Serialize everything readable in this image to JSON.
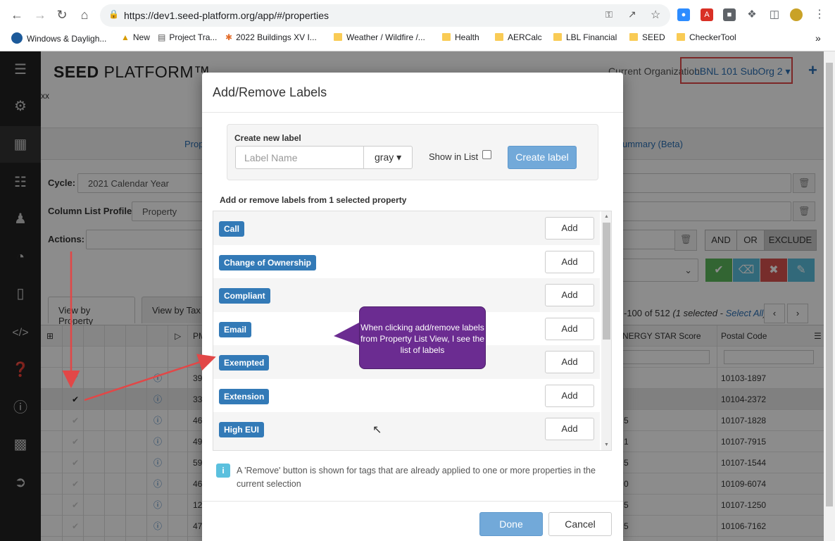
{
  "browser": {
    "url": "https://dev1.seed-platform.org/app/#/properties",
    "bookmarks": [
      "Windows & Dayligh...",
      "New",
      "Project Tra...",
      "2022 Buildings XV I...",
      "Weather / Wildfire /...",
      "Health",
      "AERCalc",
      "LBL Financial",
      "SEED",
      "CheckerTool"
    ]
  },
  "app": {
    "brand_bold": "SEED",
    "brand_rest": " PLATFORM™",
    "current_org_label": "Current Organization:",
    "current_org": "LBNL 101 SubOrg 2 ▾",
    "stray_text": "xx",
    "tab_prop": "Prop",
    "tab_summary": "ummary (Beta)",
    "cycle_label": "Cycle:",
    "cycle_value": "2021 Calendar Year",
    "column_profile_label": "Column List Profile:",
    "column_profile_value": "Property",
    "actions_label": "Actions:",
    "filter_buttons": [
      "AND",
      "OR",
      "EXCLUDE"
    ],
    "view_tabs": [
      "View by Property",
      "View by Tax L"
    ],
    "pagination": "-100 of 512",
    "pagination_selected": "(1 selected - ",
    "select_all": "Select All",
    "pagination_close": ")",
    "col_energy_star": "NERGY STAR Score",
    "col_postal": "Postal Code",
    "col_pm": "PM",
    "rows": [
      {
        "pm": "39",
        "postal": "10103-1897",
        "es": ""
      },
      {
        "pm": "33",
        "postal": "10104-2372",
        "es": ""
      },
      {
        "pm": "46",
        "postal": "10107-1828",
        "es": "5"
      },
      {
        "pm": "49",
        "postal": "10107-7915",
        "es": "1"
      },
      {
        "pm": "59",
        "postal": "10107-1544",
        "es": "5"
      },
      {
        "pm": "46",
        "postal": "10109-6074",
        "es": "0"
      },
      {
        "pm": "12",
        "postal": "10107-1250",
        "es": "5"
      },
      {
        "pm": "47",
        "postal": "10106-7162",
        "es": "5"
      }
    ]
  },
  "modal": {
    "title": "Add/Remove Labels",
    "create_heading": "Create new label",
    "label_name_placeholder": "Label Name",
    "color_value": "gray ▾",
    "show_in_list": "Show in List",
    "create_button": "Create label",
    "list_heading": "Add or remove labels from 1 selected property",
    "labels": [
      {
        "name": "Call",
        "action": "Add"
      },
      {
        "name": "Change of Ownership",
        "action": "Add"
      },
      {
        "name": "Compliant",
        "action": "Add"
      },
      {
        "name": "Email",
        "action": "Add"
      },
      {
        "name": "Exempted",
        "action": "Add"
      },
      {
        "name": "Extension",
        "action": "Add"
      },
      {
        "name": "High EUI",
        "action": "Add"
      }
    ],
    "info_text": "A 'Remove' button is shown for tags that are already applied to one or more properties in the current selection",
    "done_button": "Done",
    "cancel_button": "Cancel"
  },
  "callout": {
    "text": "When clicking add/remove labels from Property List View, I see the list of labels"
  },
  "colors": {
    "label_blue": "#337ab7",
    "primary_button": "#72a9d9",
    "callout_purple": "#6b2c91",
    "annotation_red": "#e24747"
  }
}
